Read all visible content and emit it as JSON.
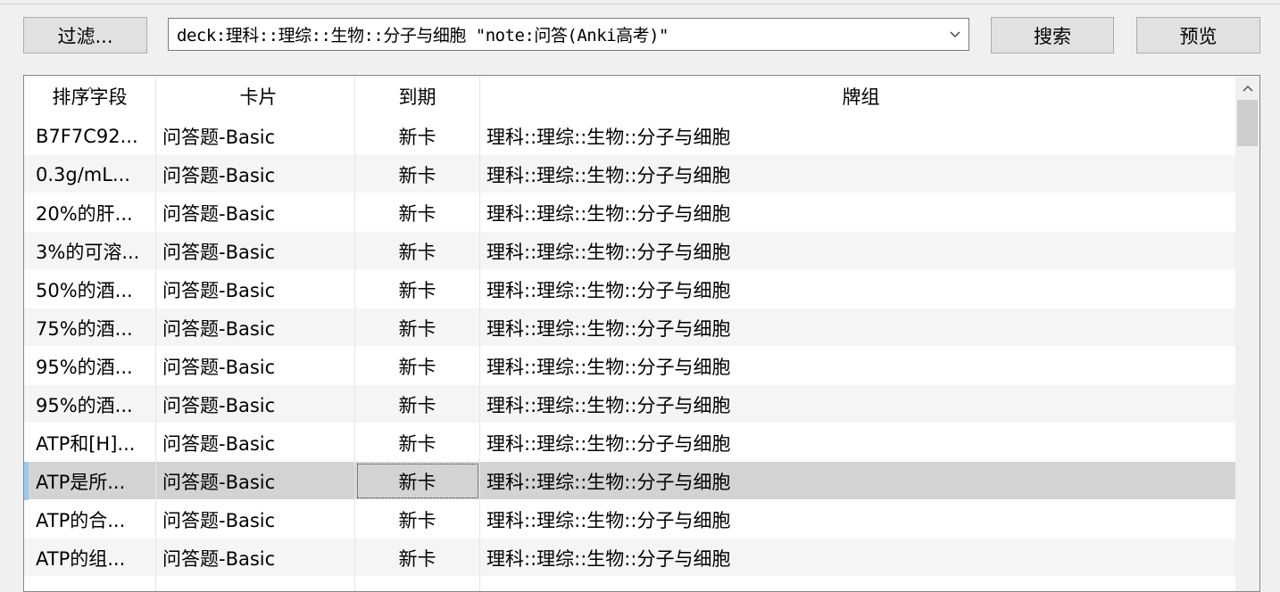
{
  "toolbar": {
    "filter_label": "过滤...",
    "search_query": "deck:理科::理综::生物::分子与细胞 \"note:问答(Anki高考)\"",
    "search_label": "搜索",
    "preview_label": "预览"
  },
  "table": {
    "columns": [
      "排序字段",
      "卡片",
      "到期",
      "牌组"
    ],
    "sort_column": "排序字段",
    "rows": [
      {
        "sort": "B7F7C92...",
        "card": "问答题-Basic",
        "due": "新卡",
        "deck": "理科::理综::生物::分子与细胞"
      },
      {
        "sort": "0.3g/mL...",
        "card": "问答题-Basic",
        "due": "新卡",
        "deck": "理科::理综::生物::分子与细胞"
      },
      {
        "sort": "20%的肝...",
        "card": "问答题-Basic",
        "due": "新卡",
        "deck": "理科::理综::生物::分子与细胞"
      },
      {
        "sort": "3%的可溶...",
        "card": "问答题-Basic",
        "due": "新卡",
        "deck": "理科::理综::生物::分子与细胞"
      },
      {
        "sort": "50%的酒...",
        "card": "问答题-Basic",
        "due": "新卡",
        "deck": "理科::理综::生物::分子与细胞"
      },
      {
        "sort": "75%的酒...",
        "card": "问答题-Basic",
        "due": "新卡",
        "deck": "理科::理综::生物::分子与细胞"
      },
      {
        "sort": "95%的酒...",
        "card": "问答题-Basic",
        "due": "新卡",
        "deck": "理科::理综::生物::分子与细胞"
      },
      {
        "sort": "95%的酒...",
        "card": "问答题-Basic",
        "due": "新卡",
        "deck": "理科::理综::生物::分子与细胞"
      },
      {
        "sort": "ATP和[H]...",
        "card": "问答题-Basic",
        "due": "新卡",
        "deck": "理科::理综::生物::分子与细胞"
      },
      {
        "sort": "ATP是所...",
        "card": "问答题-Basic",
        "due": "新卡",
        "deck": "理科::理综::生物::分子与细胞"
      },
      {
        "sort": "ATP的合...",
        "card": "问答题-Basic",
        "due": "新卡",
        "deck": "理科::理综::生物::分子与细胞"
      },
      {
        "sort": "ATP的组...",
        "card": "问答题-Basic",
        "due": "新卡",
        "deck": "理科::理综::生物::分子与细胞"
      }
    ],
    "selected_row_index": 9
  },
  "icons": {
    "combo_arrow": "chevron-down-icon",
    "sort_indicator": "chevron-up-icon",
    "scroll_up": "chevron-up-icon"
  },
  "colors": {
    "selection": "#d3d3d3",
    "selection_marker": "#99c9ef",
    "alt_row": "#f5f5f5"
  }
}
